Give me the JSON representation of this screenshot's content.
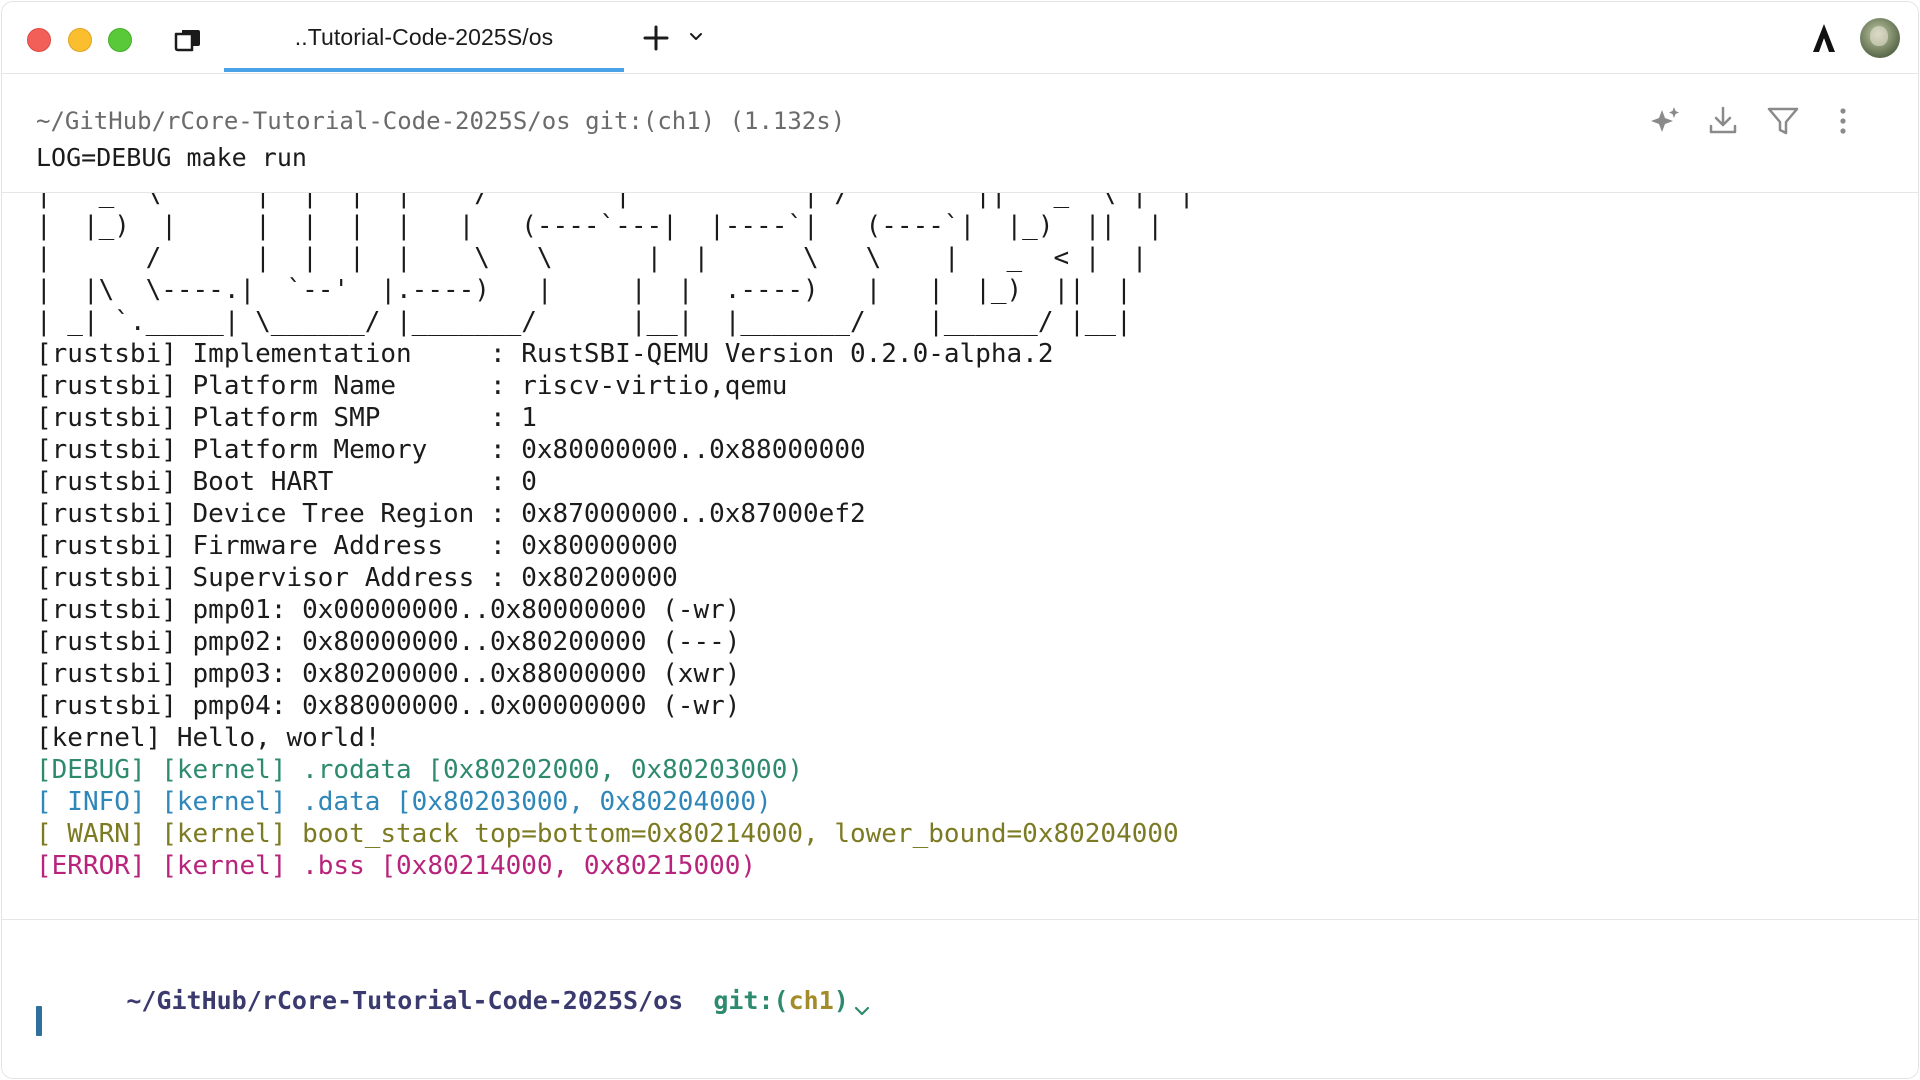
{
  "tab": {
    "title": "..Tutorial-Code-2025S/os"
  },
  "icons": {
    "panels": "panels-icon",
    "new_tab": "plus-icon",
    "tab_menu": "chevron-down-icon",
    "agent": "agent-icon",
    "avatar": "user-avatar",
    "ai_assist": "sparkle-icon",
    "save": "download-icon",
    "filter": "filter-icon",
    "more": "more-vertical-icon"
  },
  "block": {
    "prompt": "~/GitHub/rCore-Tutorial-Code-2025S/os git:(ch1) (1.132s)",
    "command": "LOG=DEBUG make run"
  },
  "output": {
    "ascii_art": [
      "|   _  \\      |  |  |  |    /        |           | /        ||   _  \\ |  |",
      "|  |_)  |     |  |  |  |   |   (----`---|  |----`|   (----`|  |_)  ||  |",
      "|      /      |  |  |  |    \\   \\      |  |      \\   \\    |   _  < |  |",
      "|  |\\  \\----.|  `--'  |.----)   |     |  |  .----)   |   |  |_)  ||  |",
      "| _| `._____| \\______/ |_______/      |__|  |_______/    |______/ |__|"
    ],
    "rustsbi_lines": [
      "[rustsbi] Implementation     : RustSBI-QEMU Version 0.2.0-alpha.2",
      "[rustsbi] Platform Name      : riscv-virtio,qemu",
      "[rustsbi] Platform SMP       : 1",
      "[rustsbi] Platform Memory    : 0x80000000..0x88000000",
      "[rustsbi] Boot HART          : 0",
      "[rustsbi] Device Tree Region : 0x87000000..0x87000ef2",
      "[rustsbi] Firmware Address   : 0x80000000",
      "[rustsbi] Supervisor Address : 0x80200000",
      "[rustsbi] pmp01: 0x00000000..0x80000000 (-wr)",
      "[rustsbi] pmp02: 0x80000000..0x80200000 (---)",
      "[rustsbi] pmp03: 0x80200000..0x88000000 (xwr)",
      "[rustsbi] pmp04: 0x88000000..0x00000000 (-wr)"
    ],
    "kernel_hello": "[kernel] Hello, world!",
    "log_debug": "[DEBUG] [kernel] .rodata [0x80202000, 0x80203000)",
    "log_info": "[ INFO] [kernel] .data [0x80203000, 0x80204000)",
    "log_warn": "[ WARN] [kernel] boot_stack top=bottom=0x80214000, lower_bound=0x80204000",
    "log_error": "[ERROR] [kernel] .bss [0x80214000, 0x80215000)"
  },
  "input": {
    "path": "~/GitHub/rCore-Tutorial-Code-2025S/os",
    "git_prefix": "git:(",
    "branch": "ch1",
    "git_suffix": ")"
  },
  "colors": {
    "tab_underline": "#4aa3e8",
    "debug": "#2e8a6e",
    "info": "#2f86b8",
    "warn": "#7c7a22",
    "error": "#b8237b",
    "cursor": "#2f6f9b"
  }
}
